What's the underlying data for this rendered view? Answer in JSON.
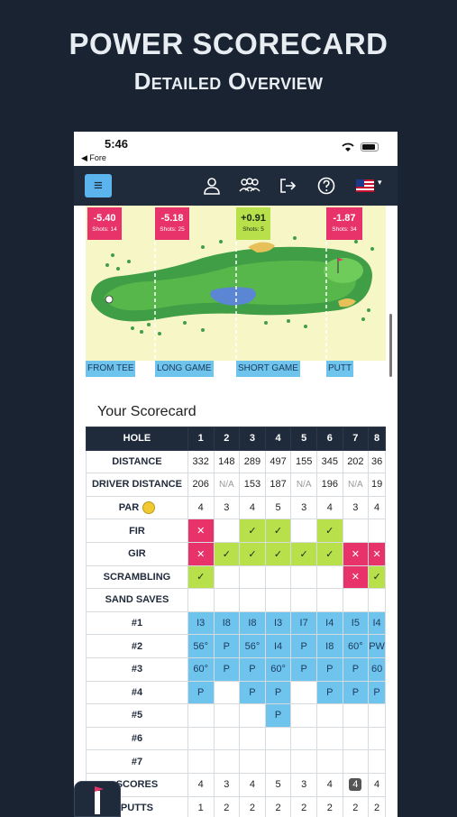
{
  "promo": {
    "title": "POWER SCORECARD",
    "subtitle": "Detailed Overview"
  },
  "status": {
    "time": "5:46",
    "back_label": "◀ Fore"
  },
  "nav": {
    "menu_glyph": "≡",
    "icons": [
      "user-icon",
      "group-icon",
      "share-icon",
      "help-icon",
      "us-flag-icon"
    ],
    "caret": "▾"
  },
  "strokes_gained": [
    {
      "value": "-5.40",
      "shots": "Shots: 14",
      "color": "#e8336a"
    },
    {
      "value": "-5.18",
      "shots": "Shots: 25",
      "color": "#e8336a"
    },
    {
      "value": "+0.91",
      "shots": "Shots: 5",
      "color": "#b7e04a"
    },
    {
      "value": "-1.87",
      "shots": "Shots: 34",
      "color": "#e8336a"
    }
  ],
  "segments": [
    "FROM TEE",
    "LONG GAME",
    "SHORT GAME",
    "PUTT"
  ],
  "scorecard": {
    "title": "Your Scorecard",
    "header": [
      "HOLE",
      "1",
      "2",
      "3",
      "4",
      "5",
      "6",
      "7",
      "8"
    ],
    "rows": [
      {
        "label": "DISTANCE",
        "cells": [
          "332",
          "148",
          "289",
          "497",
          "155",
          "345",
          "202",
          "36"
        ]
      },
      {
        "label": "DRIVER DISTANCE",
        "cells": [
          "206",
          "N/A",
          "153",
          "187",
          "N/A",
          "196",
          "N/A",
          "19"
        ]
      },
      {
        "label": "PAR",
        "cells": [
          "4",
          "3",
          "4",
          "5",
          "3",
          "4",
          "3",
          "4"
        ]
      },
      {
        "label": "FIR",
        "cells": [
          "✕",
          "",
          "✓",
          "✓",
          "",
          "✓",
          "",
          ""
        ]
      },
      {
        "label": "GIR",
        "cells": [
          "✕",
          "✓",
          "✓",
          "✓",
          "✓",
          "✓",
          "✕",
          "✕"
        ]
      },
      {
        "label": "SCRAMBLING",
        "cells": [
          "✓",
          "",
          "",
          "",
          "",
          "",
          "✕",
          "✓"
        ]
      },
      {
        "label": "SAND SAVES",
        "cells": [
          "",
          "",
          "",
          "",
          "",
          "",
          "",
          ""
        ]
      },
      {
        "label": "#1",
        "cells": [
          "I3",
          "I8",
          "I8",
          "I3",
          "I7",
          "I4",
          "I5",
          "I4"
        ]
      },
      {
        "label": "#2",
        "cells": [
          "56°",
          "P",
          "56°",
          "I4",
          "P",
          "I8",
          "60°",
          "PW"
        ]
      },
      {
        "label": "#3",
        "cells": [
          "60°",
          "P",
          "P",
          "60°",
          "P",
          "P",
          "P",
          "60"
        ]
      },
      {
        "label": "#4",
        "cells": [
          "P",
          "",
          "P",
          "P",
          "",
          "P",
          "P",
          "P"
        ]
      },
      {
        "label": "#5",
        "cells": [
          "",
          "",
          "",
          "P",
          "",
          "",
          "",
          ""
        ]
      },
      {
        "label": "#6",
        "cells": [
          "",
          "",
          "",
          "",
          "",
          "",
          "",
          ""
        ]
      },
      {
        "label": "#7",
        "cells": [
          "",
          "",
          "",
          "",
          "",
          "",
          "",
          ""
        ]
      },
      {
        "label": "SCORES",
        "cells": [
          "4",
          "3",
          "4",
          "5",
          "3",
          "4",
          "4",
          "4"
        ]
      },
      {
        "label": "PUTTS",
        "cells": [
          "1",
          "2",
          "2",
          "2",
          "2",
          "2",
          "2",
          "2"
        ]
      }
    ]
  }
}
